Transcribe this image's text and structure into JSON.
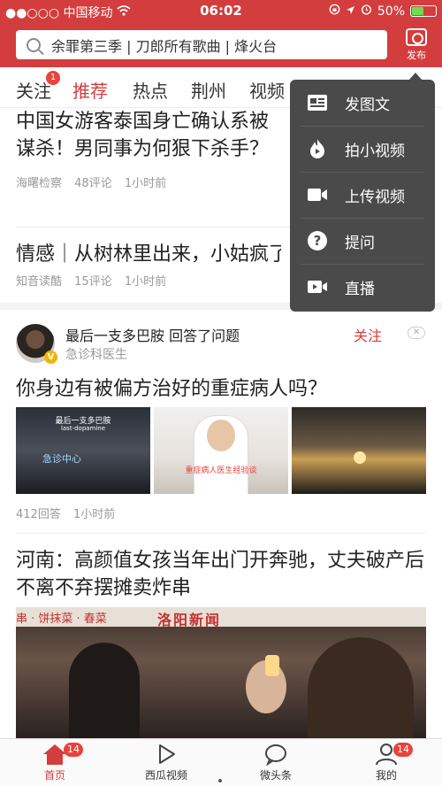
{
  "status_bar": {
    "carrier": "●●○○○ 中国移动",
    "time": "06:02",
    "battery": "50%",
    "battery_level": 0.5
  },
  "search": {
    "query": "余罪第三季 | 刀郎所有歌曲 | 烽火台",
    "icon": "search-icon"
  },
  "publish": {
    "label": "发布",
    "icon": "camera-icon"
  },
  "tabs": [
    {
      "label": "关注",
      "badge": "1"
    },
    {
      "label": "推荐"
    },
    {
      "label": "热点"
    },
    {
      "label": "荆州"
    },
    {
      "label": "视频"
    }
  ],
  "feed": {
    "article1": {
      "title": "中国女游客泰国身亡确认系被谋杀！男同事为何狠下杀手？",
      "source": "海曙检察",
      "comments": "48评论",
      "time": "1小时前"
    },
    "article2": {
      "title": "情感｜从树林里出来，小姑疯了",
      "source": "知音读酷",
      "comments": "15评论",
      "time": "1小时前"
    },
    "answer": {
      "user": "最后一支多巴胺",
      "action": "回答了问题",
      "role": "急诊科医生",
      "follow": "关注",
      "close": "✕",
      "verified": "V",
      "question": "你身边有被偏方治好的重症病人吗？",
      "thumb1_caption": "最后一支多巴胺",
      "thumb1_sub": "last-dopamine",
      "thumb1_sign": "急诊中心",
      "thumb2_caption": "重症病人医生经验谈",
      "answers": "412回答",
      "time": "1小时前"
    },
    "article3": {
      "title": "河南：高颜值女孩当年出门开奔驰，丈夫破产后不离不弃摆摊卖炸串",
      "sign_left": "串 · 饼抹菜 · 春菜",
      "sign_right": "洛阳新闻"
    }
  },
  "popup_menu": [
    {
      "label": "发图文",
      "icon": "article-icon"
    },
    {
      "label": "拍小视频",
      "icon": "flame-video-icon"
    },
    {
      "label": "上传视频",
      "icon": "video-camera-icon"
    },
    {
      "label": "提问",
      "icon": "question-icon"
    },
    {
      "label": "直播",
      "icon": "live-icon"
    }
  ],
  "bottom_tabs": [
    {
      "label": "首页",
      "badge": "14",
      "icon": "home-icon"
    },
    {
      "label": "西瓜视频",
      "icon": "play-icon"
    },
    {
      "label": "微头条",
      "icon": "chat-bubble-icon"
    },
    {
      "label": "我的",
      "badge": "14",
      "icon": "user-icon"
    }
  ],
  "colors": {
    "brand_red": "#d43d3d",
    "menu_bg": "#4a4a4a"
  }
}
